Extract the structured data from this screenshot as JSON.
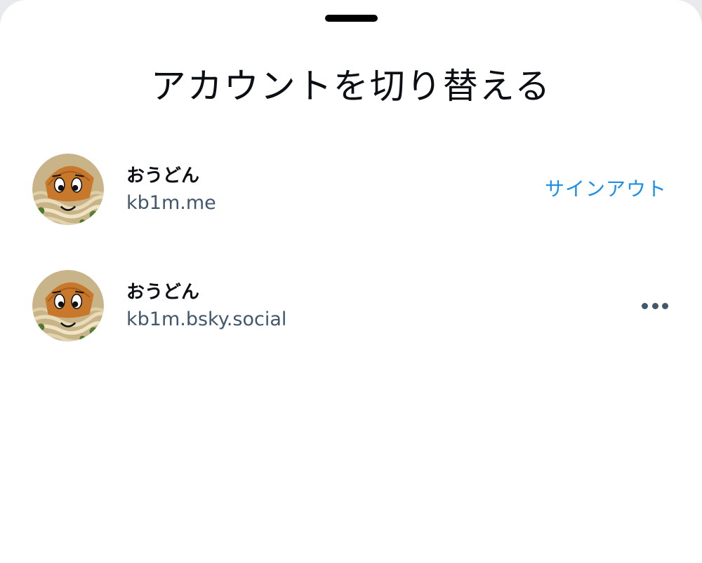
{
  "sheet": {
    "title": "アカウントを切り替える"
  },
  "accounts": [
    {
      "display_name": "おうどん",
      "handle": "kb1m.me",
      "action_label": "サインアウト",
      "avatar_icon": "udon-avatar-icon"
    },
    {
      "display_name": "おうどん",
      "handle": "kb1m.bsky.social",
      "action_icon": "more-horizontal-icon",
      "avatar_icon": "udon-avatar-icon"
    }
  ],
  "colors": {
    "accent": "#1d8fe9",
    "text_primary": "#0b0f14",
    "text_secondary": "#42576c",
    "background": "#ffffff"
  }
}
